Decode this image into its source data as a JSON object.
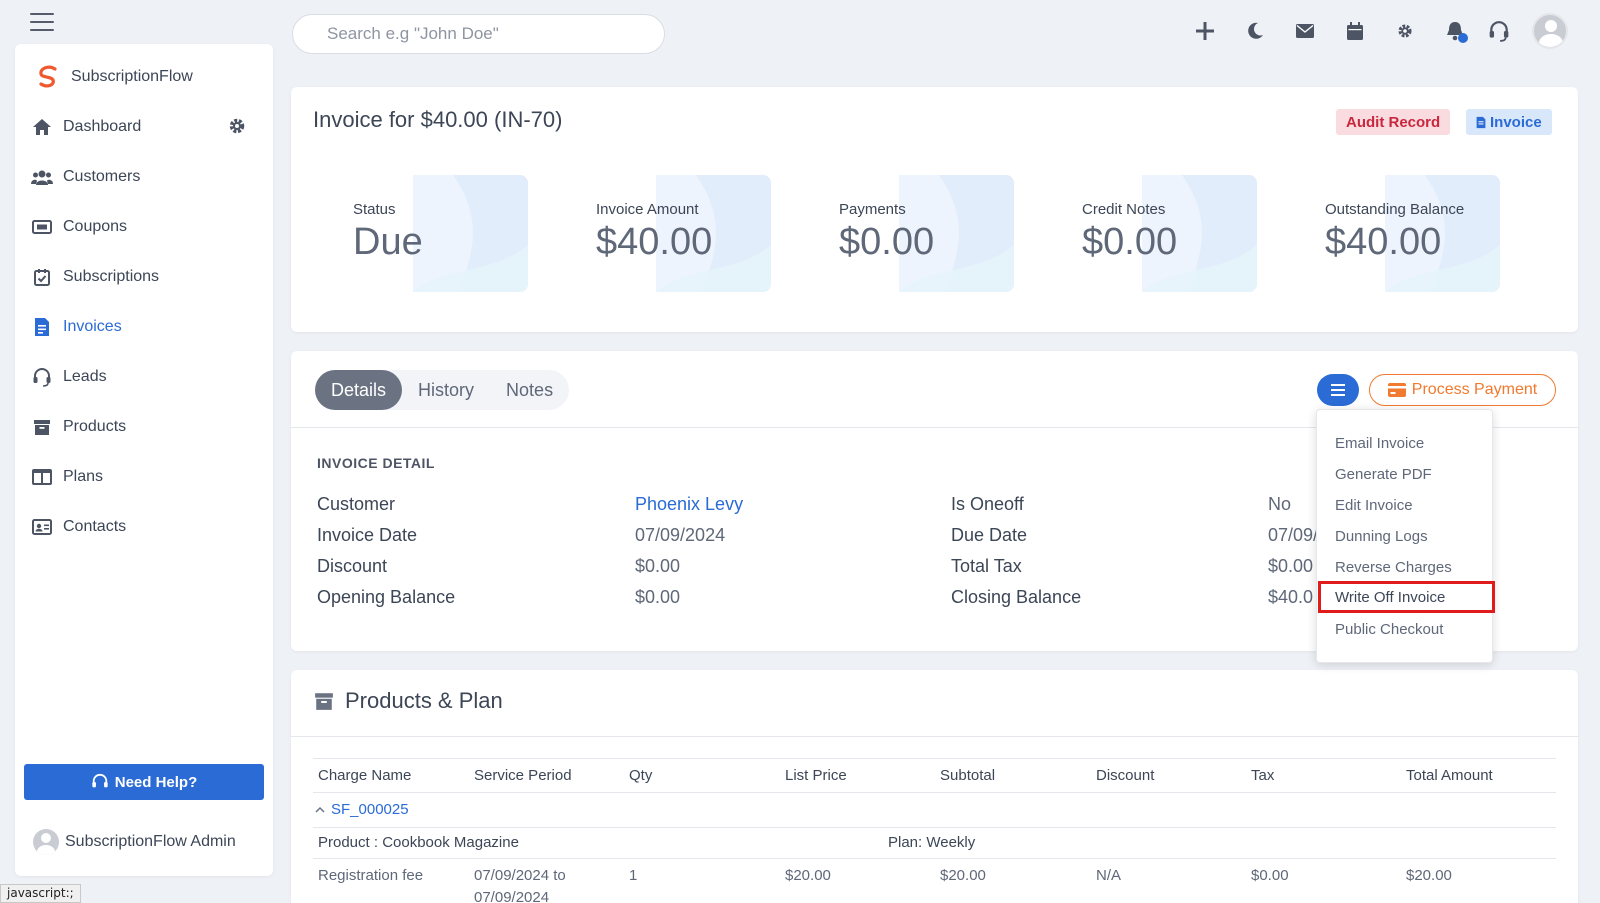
{
  "search": {
    "placeholder": "Search e.g \"John Doe\""
  },
  "brand": {
    "name": "SubscriptionFlow"
  },
  "sidebar": {
    "items": [
      {
        "label": "Dashboard",
        "icon": "home-icon"
      },
      {
        "label": "Customers",
        "icon": "users-icon"
      },
      {
        "label": "Coupons",
        "icon": "ticket-icon"
      },
      {
        "label": "Subscriptions",
        "icon": "calendar-check-icon"
      },
      {
        "label": "Invoices",
        "icon": "invoice-icon",
        "active": true
      },
      {
        "label": "Leads",
        "icon": "headset-icon"
      },
      {
        "label": "Products",
        "icon": "archive-icon"
      },
      {
        "label": "Plans",
        "icon": "columns-icon"
      },
      {
        "label": "Contacts",
        "icon": "contact-card-icon"
      }
    ],
    "help_label": "Need Help?",
    "admin_name": "SubscriptionFlow Admin"
  },
  "statusbar": {
    "text": "javascript:;"
  },
  "invoice": {
    "title": "Invoice for $40.00 (IN-70)",
    "audit_label": "Audit Record",
    "invoice_label": "Invoice",
    "stats": [
      {
        "label": "Status",
        "value": "Due"
      },
      {
        "label": "Invoice Amount",
        "value": "$40.00"
      },
      {
        "label": "Payments",
        "value": "$0.00"
      },
      {
        "label": "Credit Notes",
        "value": "$0.00"
      },
      {
        "label": "Outstanding Balance",
        "value": "$40.00"
      }
    ]
  },
  "details": {
    "tabs": [
      "Details",
      "History",
      "Notes"
    ],
    "process_payment_label": "Process Payment",
    "section_label": "INVOICE DETAIL",
    "left": [
      {
        "key": "Customer",
        "value": "Phoenix Levy"
      },
      {
        "key": "Invoice Date",
        "value": "07/09/2024"
      },
      {
        "key": "Discount",
        "value": "$0.00"
      },
      {
        "key": "Opening Balance",
        "value": "$0.00"
      }
    ],
    "right": [
      {
        "key": "Is Oneoff",
        "value": "No"
      },
      {
        "key": "Due Date",
        "value": "07/09/"
      },
      {
        "key": "Total Tax",
        "value": "$0.00"
      },
      {
        "key": "Closing Balance",
        "value": "$40.0"
      }
    ]
  },
  "menu": {
    "items": [
      "Email Invoice",
      "Generate PDF",
      "Edit Invoice",
      "Dunning Logs",
      "Reverse Charges",
      "Write Off Invoice",
      "Public Checkout"
    ]
  },
  "products": {
    "title": "Products & Plan",
    "headers": [
      "Charge Name",
      "Service Period",
      "Qty",
      "List Price",
      "Subtotal",
      "Discount",
      "Tax",
      "Total Amount"
    ],
    "subscription_id": "SF_000025",
    "product_label": "Product : Cookbook Magazine",
    "plan_label": "Plan: Weekly",
    "rows": [
      {
        "charge": "Registration fee",
        "period_start": "07/09/2024 to",
        "period_end": "07/09/2024",
        "qty": "1",
        "list_price": "$20.00",
        "subtotal": "$20.00",
        "discount": "N/A",
        "tax": "$0.00",
        "total": "$20.00"
      }
    ]
  },
  "colors": {
    "accent": "#2a6bd6",
    "orange": "#f07a2f",
    "danger": "#c8283e",
    "highlight_box": "#e01b1b"
  }
}
